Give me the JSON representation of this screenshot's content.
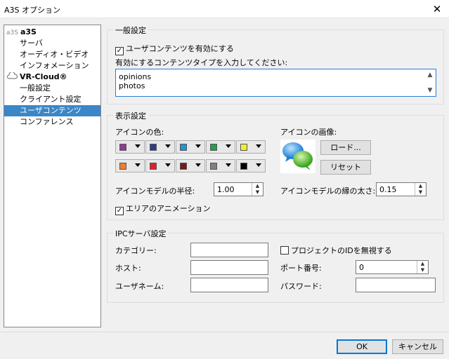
{
  "window": {
    "title": "A3S オプション"
  },
  "tree": {
    "items": [
      {
        "label": "a3S",
        "root": true,
        "icon": "a3s"
      },
      {
        "label": "サーバ"
      },
      {
        "label": "オーディオ・ビデオ"
      },
      {
        "label": "インフォメーション"
      },
      {
        "label": "VR-Cloud®",
        "root": true,
        "icon": "cloud"
      },
      {
        "label": "一般設定"
      },
      {
        "label": "クライアント設定"
      },
      {
        "label": "ユーザコンテンツ",
        "selected": true
      },
      {
        "label": "コンファレンス"
      }
    ]
  },
  "general": {
    "legend": "一般設定",
    "enable_label": "ユーザコンテンツを有効にする",
    "types_label": "有効にするコンテンツタイプを入力してください:",
    "types": [
      "opinions",
      "photos"
    ]
  },
  "display": {
    "legend": "表示設定",
    "icon_color_label": "アイコンの色:",
    "icon_image_label": "アイコンの画像:",
    "load_button": "ロード...",
    "reset_button": "リセット",
    "colors": [
      "#8e3a97",
      "#2e3d8f",
      "#2196d6",
      "#23a048",
      "#f3ee2d",
      "#ef7d30",
      "#de2030",
      "#741b1f",
      "#808080",
      "#000000"
    ],
    "radius_label": "アイコンモデルの半径:",
    "radius_value": "1.00",
    "edge_label": "アイコンモデルの縁の太さ:",
    "edge_value": "0.15",
    "animation_label": "エリアのアニメーション"
  },
  "ipc": {
    "legend": "IPCサーバ設定",
    "category_label": "カテゴリー:",
    "host_label": "ホスト:",
    "username_label": "ユーザネーム:",
    "ignore_label": "プロジェクトのIDを無視する",
    "port_label": "ポート番号:",
    "port_value": "0",
    "password_label": "パスワード:"
  },
  "footer": {
    "ok": "OK",
    "cancel": "キャンセル"
  }
}
